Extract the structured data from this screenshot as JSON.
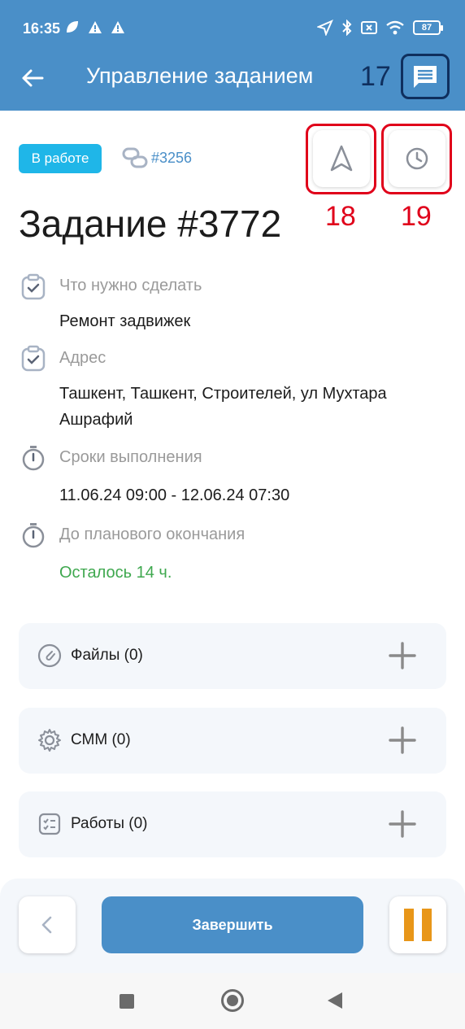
{
  "status_bar": {
    "time": "16:35",
    "battery": "87"
  },
  "header": {
    "title": "Управление заданием",
    "annotation": "17"
  },
  "task": {
    "status_badge": "В работе",
    "link": "#3256",
    "title": "Задание #3772"
  },
  "actions": {
    "navigate_annotation": "18",
    "history_annotation": "19"
  },
  "details": [
    {
      "label": "Что нужно сделать",
      "value": "Ремонт задвижек"
    },
    {
      "label": "Адрес",
      "value": "Ташкент, Ташкент, Строителей, ул Мухтара Ашрафий"
    },
    {
      "label": "Сроки выполнения",
      "value": "11.06.24 09:00 - 12.06.24 07:30"
    },
    {
      "label": "До планового окончания",
      "value": "Осталось  14 ч."
    }
  ],
  "cards": [
    {
      "label": "Файлы (0)"
    },
    {
      "label": "СММ (0)"
    },
    {
      "label": "Работы (0)"
    }
  ],
  "bottom": {
    "finish_label": "Завершить"
  },
  "colors": {
    "primary": "#4a8fc8",
    "badge": "#1fb6e8",
    "annotation_red": "#e0001a",
    "annotation_navy": "#0f2f5e",
    "success": "#3fa84f",
    "pause": "#e89619"
  }
}
